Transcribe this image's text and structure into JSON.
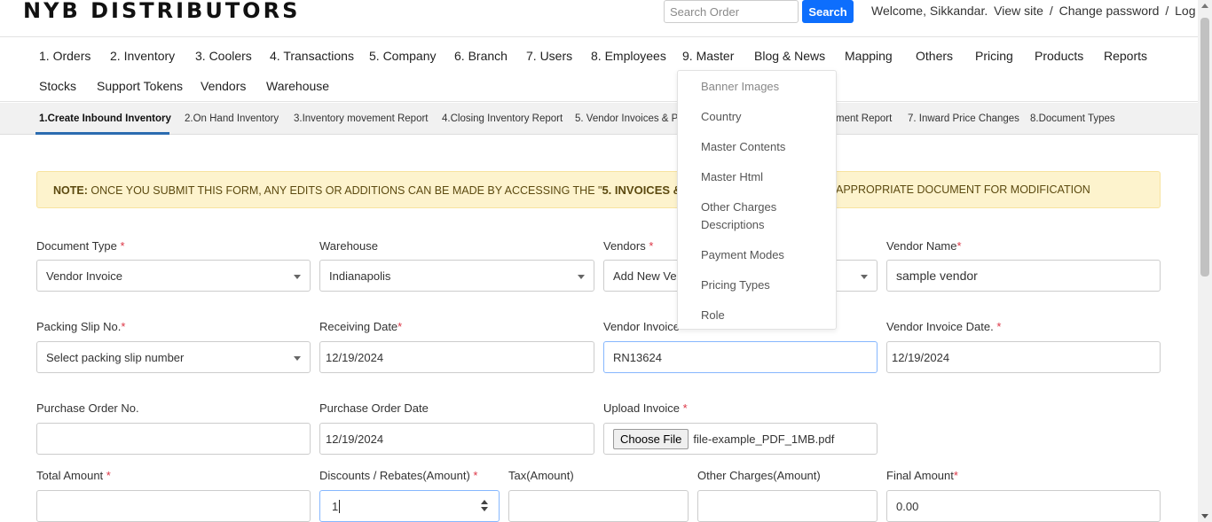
{
  "brand": {
    "logo": "NYB DISTRIBUTORS"
  },
  "header": {
    "search_placeholder": "Search Order",
    "search_button": "Search",
    "welcome": "Welcome, Sikkandar.",
    "view_site": "View site",
    "separator": "/",
    "change_password": "Change password",
    "log_out": "Log out"
  },
  "nav": [
    "1. Orders",
    "2. Inventory",
    "3. Coolers",
    "4. Transactions",
    "5. Company",
    "6. Branch",
    "7. Users",
    "8. Employees",
    "9. Master",
    "Blog & News",
    "Mapping",
    "Others",
    "Pricing",
    "Products",
    "Reports",
    "Stocks",
    "Support Tokens",
    "Vendors",
    "Warehouse"
  ],
  "subnav": [
    "1.Create Inbound Inventory",
    "2.On Hand Inventory",
    "3.Inventory movement Report",
    "4.Closing Inventory Report",
    "5. Vendor Invoices & Pa",
    "ment Report",
    "7. Inward Price Changes",
    "8.Document Types"
  ],
  "note": {
    "prefix": "NOTE:",
    "text_a": " ONCE YOU SUBMIT THIS FORM, ANY EDITS OR ADDITIONS CAN BE MADE BY ACCESSING THE \"",
    "highlight": "5. INVOICES & PACKIN",
    "text_b": "APPROPRIATE DOCUMENT FOR MODIFICATION"
  },
  "master_menu": [
    "Banner Images",
    "Country",
    "Master Contents",
    "Master Html",
    "Other Charges Descriptions",
    "Payment Modes",
    "Pricing Types",
    "Role"
  ],
  "form": {
    "document_type": {
      "label": "Document Type",
      "value": "Vendor Invoice"
    },
    "warehouse": {
      "label": "Warehouse",
      "value": "Indianapolis"
    },
    "vendors": {
      "label": "Vendors",
      "value": "Add New Ven"
    },
    "vendor_name": {
      "label": "Vendor Name",
      "value": "sample vendor"
    },
    "packing_slip": {
      "label": "Packing Slip No.",
      "value": "Select packing slip number"
    },
    "receiving_date": {
      "label": "Receiving Date",
      "value": "12/19/2024"
    },
    "vendor_invoice": {
      "label": "Vendor Invoice",
      "value": "RN13624"
    },
    "vendor_invoice_date": {
      "label": "Vendor Invoice Date.",
      "value": "12/19/2024"
    },
    "purchase_order_no": {
      "label": "Purchase Order No.",
      "value": ""
    },
    "purchase_order_date": {
      "label": "Purchase Order Date",
      "value": "12/19/2024"
    },
    "upload_invoice": {
      "label": "Upload Invoice",
      "button": "Choose File",
      "filename": "file-example_PDF_1MB.pdf"
    },
    "total_amount": {
      "label": "Total Amount",
      "value": ""
    },
    "discounts": {
      "label": "Discounts / Rebates(Amount)",
      "value": "1"
    },
    "tax": {
      "label": "Tax(Amount)",
      "value": ""
    },
    "other_charges": {
      "label": "Other Charges(Amount)",
      "value": ""
    },
    "final_amount": {
      "label": "Final Amount",
      "value": "0.00"
    }
  },
  "required_marker": "*",
  "colors": {
    "accent": "#0d6efd",
    "note_bg": "#fdf3cd",
    "required": "#dc3545"
  }
}
